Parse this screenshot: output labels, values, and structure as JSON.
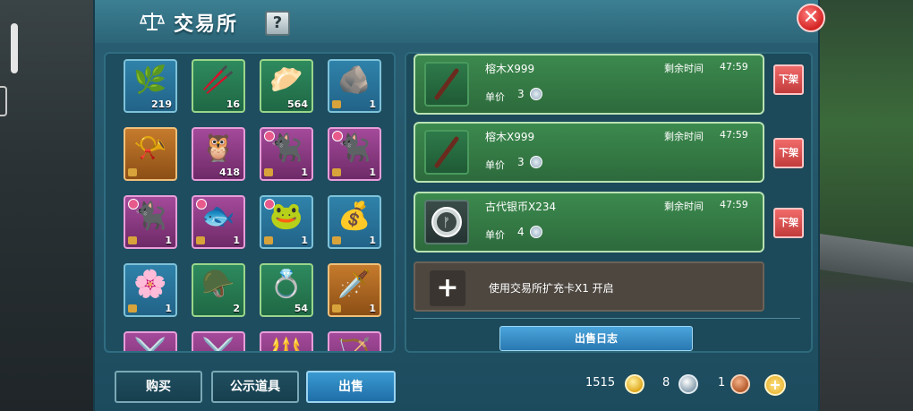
{
  "window": {
    "title": "交易所",
    "help_label": "?",
    "close_label": "✕"
  },
  "inventory": [
    {
      "icon": "leaf-icon",
      "glyph": "🌿",
      "count": "219",
      "style": "blue"
    },
    {
      "icon": "branch-icon",
      "glyph": "🥢",
      "count": "16",
      "style": "green"
    },
    {
      "icon": "dumpling-icon",
      "glyph": "🥟",
      "count": "564",
      "style": "green"
    },
    {
      "icon": "stone-icon",
      "glyph": "🪨",
      "count": "1",
      "style": "blue"
    },
    {
      "icon": "horn-icon",
      "glyph": "📯",
      "count": "",
      "style": "orange"
    },
    {
      "icon": "creature-icon",
      "glyph": "🦉",
      "count": "418",
      "style": "purple"
    },
    {
      "icon": "cat-card-icon",
      "glyph": "🐈‍⬛",
      "count": "1",
      "style": "purple"
    },
    {
      "icon": "cat-card-icon",
      "glyph": "🐈‍⬛",
      "count": "1",
      "style": "purple"
    },
    {
      "icon": "cat-card-icon",
      "glyph": "🐈‍⬛",
      "count": "1",
      "style": "purple"
    },
    {
      "icon": "fish-card-icon",
      "glyph": "🐟",
      "count": "1",
      "style": "purple"
    },
    {
      "icon": "creature-card-icon",
      "glyph": "🐸",
      "count": "1",
      "style": "blue"
    },
    {
      "icon": "money-bag-icon",
      "glyph": "💰",
      "count": "1",
      "style": "blue"
    },
    {
      "icon": "flower-bag-icon",
      "glyph": "🌸",
      "count": "1",
      "style": "blue"
    },
    {
      "icon": "saddle-icon",
      "glyph": "🪖",
      "count": "2",
      "style": "green"
    },
    {
      "icon": "ring-icon",
      "glyph": "💍",
      "count": "54",
      "style": "green"
    },
    {
      "icon": "sword-icon",
      "glyph": "🗡️",
      "count": "1",
      "style": "orange"
    },
    {
      "icon": "weapon-icon",
      "glyph": "⚔️",
      "count": "",
      "style": "purple"
    },
    {
      "icon": "weapon-icon",
      "glyph": "⚔️",
      "count": "",
      "style": "purple"
    },
    {
      "icon": "weapon-icon",
      "glyph": "🔱",
      "count": "",
      "style": "purple"
    },
    {
      "icon": "weapon-icon",
      "glyph": "🏹",
      "count": "",
      "style": "purple"
    }
  ],
  "tabs": {
    "buy": "购买",
    "public": "公示道具",
    "sell": "出售"
  },
  "listings": [
    {
      "name": "榕木X999",
      "time_label": "剩余时间",
      "time": "47:59",
      "price_label": "单价",
      "price": "3",
      "unlist": "下架",
      "icon": "branch-icon"
    },
    {
      "name": "榕木X999",
      "time_label": "剩余时间",
      "time": "47:59",
      "price_label": "单价",
      "price": "3",
      "unlist": "下架",
      "icon": "branch-icon"
    },
    {
      "name": "古代银币X234",
      "time_label": "剩余时间",
      "time": "47:59",
      "price_label": "单价",
      "price": "4",
      "unlist": "下架",
      "icon": "ancient-coin-icon"
    }
  ],
  "expand": {
    "plus": "+",
    "text": "使用交易所扩充卡X1 开启"
  },
  "sale_log": "出售日志",
  "currency": {
    "gold": "1515",
    "silver": "8",
    "bronze": "1",
    "add": "+"
  },
  "colors": {
    "panel": "#1e4d60",
    "listing": "#3c8a4e",
    "unlist": "#d94a4a",
    "accent": "#3a9ad1"
  }
}
